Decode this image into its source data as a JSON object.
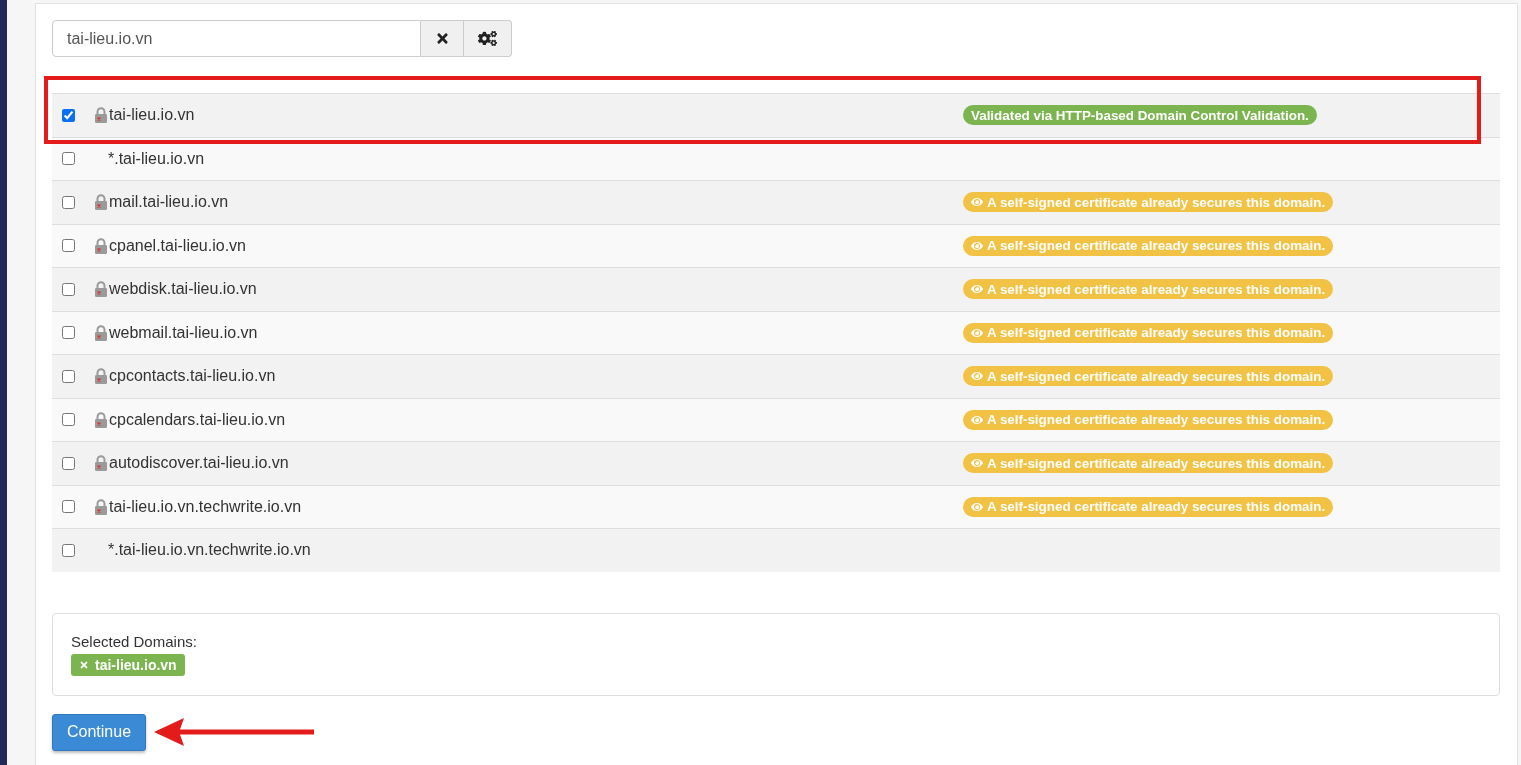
{
  "search": {
    "value": "tai-lieu.io.vn"
  },
  "domains": [
    {
      "name": "tai-lieu.io.vn",
      "checked": true,
      "highlighted": true,
      "lock_icon": true,
      "status": {
        "kind": "validated",
        "text": "Validated via HTTP-based Domain Control Validation."
      }
    },
    {
      "name": "*.tai-lieu.io.vn",
      "checked": false,
      "highlighted": false,
      "lock_icon": false
    },
    {
      "name": "mail.tai-lieu.io.vn",
      "checked": false,
      "highlighted": false,
      "lock_icon": true,
      "status": {
        "kind": "self_signed",
        "text": "A self-signed certificate already secures this domain."
      }
    },
    {
      "name": "cpanel.tai-lieu.io.vn",
      "checked": false,
      "highlighted": false,
      "lock_icon": true,
      "status": {
        "kind": "self_signed",
        "text": "A self-signed certificate already secures this domain."
      }
    },
    {
      "name": "webdisk.tai-lieu.io.vn",
      "checked": false,
      "highlighted": false,
      "lock_icon": true,
      "status": {
        "kind": "self_signed",
        "text": "A self-signed certificate already secures this domain."
      }
    },
    {
      "name": "webmail.tai-lieu.io.vn",
      "checked": false,
      "highlighted": false,
      "lock_icon": true,
      "status": {
        "kind": "self_signed",
        "text": "A self-signed certificate already secures this domain."
      }
    },
    {
      "name": "cpcontacts.tai-lieu.io.vn",
      "checked": false,
      "highlighted": false,
      "lock_icon": true,
      "status": {
        "kind": "self_signed",
        "text": "A self-signed certificate already secures this domain."
      }
    },
    {
      "name": "cpcalendars.tai-lieu.io.vn",
      "checked": false,
      "highlighted": false,
      "lock_icon": true,
      "status": {
        "kind": "self_signed",
        "text": "A self-signed certificate already secures this domain."
      }
    },
    {
      "name": "autodiscover.tai-lieu.io.vn",
      "checked": false,
      "highlighted": false,
      "lock_icon": true,
      "status": {
        "kind": "self_signed",
        "text": "A self-signed certificate already secures this domain."
      }
    },
    {
      "name": "tai-lieu.io.vn.techwrite.io.vn",
      "checked": false,
      "highlighted": false,
      "lock_icon": true,
      "status": {
        "kind": "self_signed",
        "text": "A self-signed certificate already secures this domain."
      }
    },
    {
      "name": "*.tai-lieu.io.vn.techwrite.io.vn",
      "checked": false,
      "highlighted": false,
      "lock_icon": false
    }
  ],
  "selected_domains": {
    "label": "Selected Domains:",
    "tags": [
      {
        "label": "tai-lieu.io.vn"
      }
    ]
  },
  "continue_button": {
    "label": "Continue",
    "arrow_pointer": true
  }
}
